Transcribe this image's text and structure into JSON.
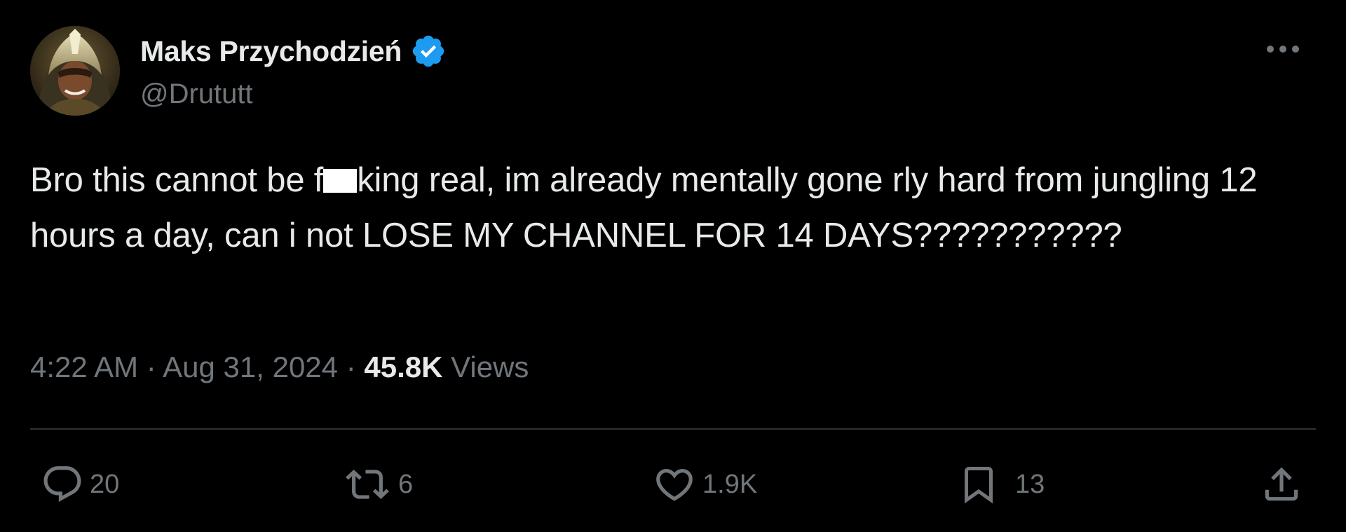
{
  "tweet": {
    "author": {
      "display_name": "Maks Przychodzień",
      "handle": "@Drututt",
      "verified": true,
      "verified_color": "#1d9bf0"
    },
    "text_parts": {
      "before_redaction": "Bro this cannot be f",
      "after_redaction": "king real, im already mentally gone rly hard from jungling 12 hours a day, can i not LOSE MY CHANNEL FOR 14 DAYS???????????"
    },
    "timestamp": {
      "time": "4:22 AM",
      "date": "Aug 31, 2024",
      "separator": "·",
      "views_count": "45.8K",
      "views_label": "Views"
    },
    "actions": {
      "reply": {
        "icon": "reply-icon",
        "count": "20"
      },
      "retweet": {
        "icon": "retweet-icon",
        "count": "6"
      },
      "like": {
        "icon": "heart-icon",
        "count": "1.9K"
      },
      "bookmark": {
        "icon": "bookmark-icon",
        "count": "13"
      },
      "share": {
        "icon": "share-icon"
      }
    }
  },
  "colors": {
    "background": "#000000",
    "primary_text": "#e7e9ea",
    "secondary_text": "#71767b",
    "divider": "#2f3336",
    "verified": "#1d9bf0"
  }
}
